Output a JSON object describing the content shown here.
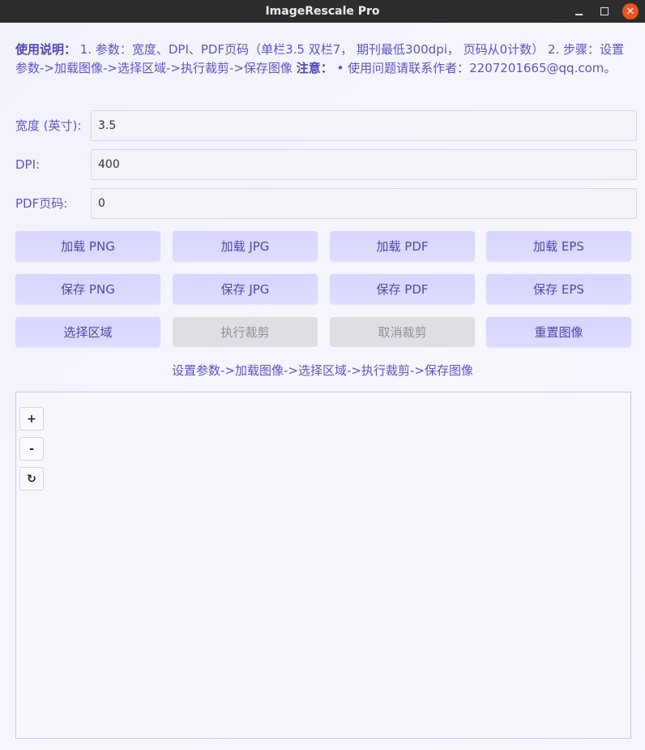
{
  "window": {
    "title": "ImageRescale Pro"
  },
  "instructions": {
    "heading": "使用说明：",
    "text1": " 1. 参数：宽度、DPI、PDF页码（单栏3.5 双栏7， 期刊最低300dpi， 页码从0计数） 2. 步骤：设置参数->加载图像->选择区域->执行裁剪->保存图像 ",
    "note_heading": "注意：",
    "text2": " • 使用问题请联系作者：2207201665@qq.com。"
  },
  "form": {
    "width_label": "宽度 (英寸):",
    "width_value": "3.5",
    "dpi_label": "DPI:",
    "dpi_value": "400",
    "page_label": "PDF页码:",
    "page_value": "0"
  },
  "buttons": {
    "load_png": "加载 PNG",
    "load_jpg": "加载 JPG",
    "load_pdf": "加载 PDF",
    "load_eps": "加载 EPS",
    "save_png": "保存 PNG",
    "save_jpg": "保存 JPG",
    "save_pdf": "保存 PDF",
    "save_eps": "保存 EPS",
    "select_area": "选择区域",
    "crop": "执行裁剪",
    "cancel_crop": "取消裁剪",
    "reset": "重置图像"
  },
  "flow_text": "设置参数->加载图像->选择区域->执行裁剪->保存图像",
  "canvas_tools": {
    "zoom_in": "+",
    "zoom_out": "-",
    "rotate": "↻"
  },
  "colors": {
    "accent_text": "#5b54c4",
    "button_bg": "#d8d7ff",
    "close_button": "#e9541f"
  }
}
